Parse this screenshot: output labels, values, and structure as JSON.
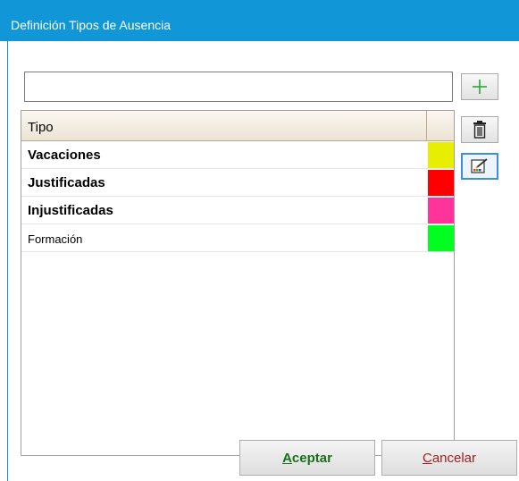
{
  "window": {
    "title": "Definición Tipos de Ausencia"
  },
  "name_input": {
    "value": "",
    "placeholder": ""
  },
  "toolbar": {
    "add_icon": "plus-icon",
    "delete_icon": "trash-icon",
    "edit_icon": "edit-color-icon"
  },
  "list": {
    "header": "Tipo",
    "rows": [
      {
        "label": "Vacaciones",
        "bold": true,
        "color": "#e8ee00"
      },
      {
        "label": "Justificadas",
        "bold": true,
        "color": "#ff0000"
      },
      {
        "label": "Injustificadas",
        "bold": true,
        "color": "#ff3399"
      },
      {
        "label": "Formación",
        "bold": false,
        "color": "#00ff21"
      }
    ]
  },
  "buttons": {
    "ok_mnemonic": "A",
    "ok_rest": "ceptar",
    "cancel_mnemonic": "C",
    "cancel_rest": "ancelar"
  },
  "colors": {
    "titlebar": "#1196d8",
    "ok_text": "#1a6f1a",
    "cancel_text": "#a02020",
    "add_icon": "#2ea52e"
  }
}
